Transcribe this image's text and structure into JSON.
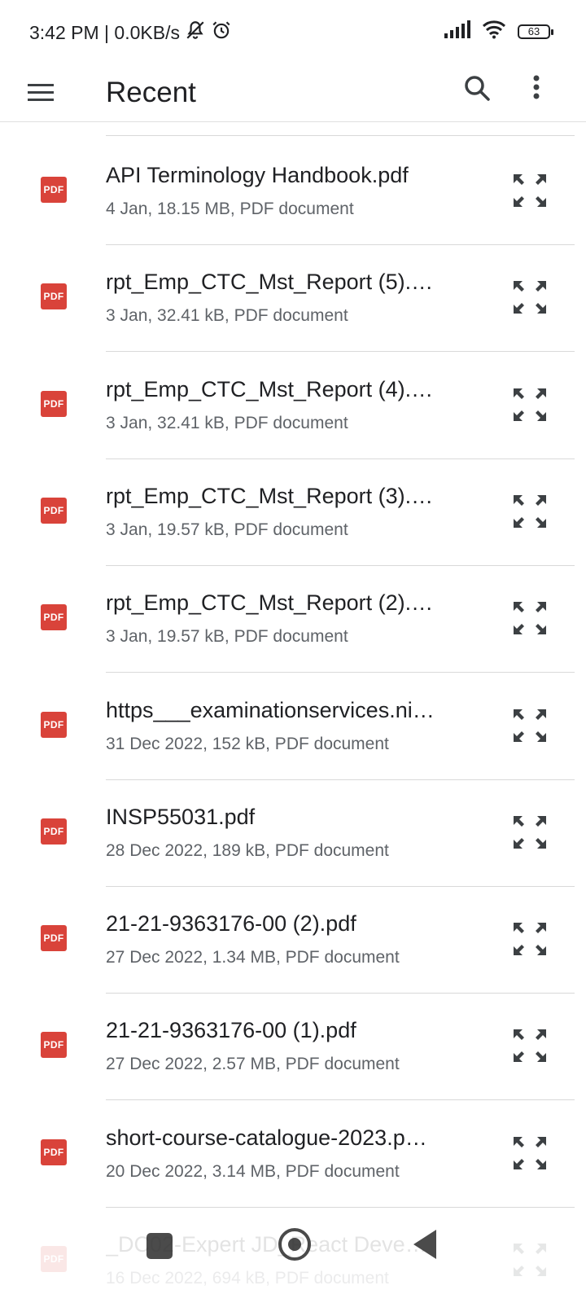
{
  "status_bar": {
    "time_speed": "3:42 PM | 0.0KB/s",
    "battery_level": "63",
    "icons": [
      "mute-icon",
      "alarm-icon",
      "signal-icon",
      "wifi-icon",
      "battery-icon"
    ]
  },
  "app_bar": {
    "title": "Recent",
    "icons": [
      "menu-icon",
      "search-icon",
      "more-vert-icon"
    ]
  },
  "file_icon_label": "PDF",
  "files": [
    {
      "name": "API Terminology Handbook.pdf",
      "meta": "4 Jan, 18.15 MB, PDF document"
    },
    {
      "name": "rpt_Emp_CTC_Mst_Report (5).…",
      "meta": "3 Jan, 32.41 kB, PDF document"
    },
    {
      "name": "rpt_Emp_CTC_Mst_Report (4).…",
      "meta": "3 Jan, 32.41 kB, PDF document"
    },
    {
      "name": "rpt_Emp_CTC_Mst_Report (3).…",
      "meta": "3 Jan, 19.57 kB, PDF document"
    },
    {
      "name": "rpt_Emp_CTC_Mst_Report (2).…",
      "meta": "3 Jan, 19.57 kB, PDF document"
    },
    {
      "name": "https___examinationservices.ni…",
      "meta": "31 Dec 2022, 152 kB, PDF document"
    },
    {
      "name": "INSP55031.pdf",
      "meta": "28 Dec 2022, 189 kB, PDF document"
    },
    {
      "name": "21-21-9363176-00 (2).pdf",
      "meta": "27 Dec 2022, 1.34 MB, PDF document"
    },
    {
      "name": "21-21-9363176-00 (1).pdf",
      "meta": "27 Dec 2022, 2.57 MB, PDF document"
    },
    {
      "name": "short-course-catalogue-2023.p…",
      "meta": "20 Dec 2022, 3.14 MB, PDF document"
    },
    {
      "name": "_DC02-Expert JD_React Deve…",
      "meta": "16 Dec 2022, 694 kB, PDF document"
    }
  ],
  "nav_bar": {
    "icons": [
      "recents-icon",
      "home-icon",
      "back-icon"
    ]
  },
  "colors": {
    "pdf_red": "#d9433a",
    "text_primary": "#202124",
    "text_secondary": "#5f6368",
    "divider": "#d9d9d9"
  }
}
